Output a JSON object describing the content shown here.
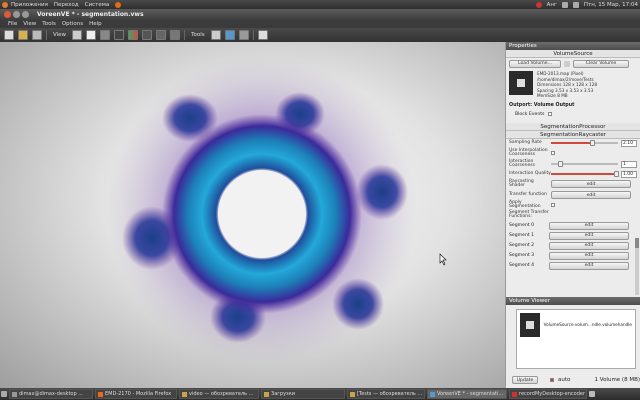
{
  "top_panel": {
    "menus": [
      "Приложения",
      "Переход",
      "Система"
    ],
    "clock": "Птн, 15 Мар, 17:04",
    "keyboard": "Анг"
  },
  "window": {
    "title": "VoreenVE * - segmentation.vws"
  },
  "menubar": [
    "File",
    "View",
    "Tools",
    "Options",
    "Help"
  ],
  "toolbar": {
    "view_label": "View",
    "tools_label": "Tools"
  },
  "properties": {
    "dock_title": "Properties",
    "volume_source": {
      "title": "VolumeSource",
      "load_button": "Load Volume...",
      "clear_button": "Clear Volume",
      "filename": "EMD-2013.map (Pixel)",
      "path": "/home/dimax/2/move/Tests",
      "dimensions": "Dimensions  128 x 128 x 128",
      "spacing": "Spacing  3.53 x 3.53 x 3.53",
      "memsize": "MemSize  8 MB",
      "outport": "Outport: Volume Output",
      "block_events": "Block Events"
    },
    "segmentation_processor": {
      "title": "SegmentationProcessor"
    },
    "raycaster": {
      "title": "SegmentationRaycaster",
      "sampling_rate_label": "Sampling Rate",
      "sampling_rate_value": "2.10",
      "sampling_rate": 0.62,
      "use_interp_label": "Use Interpolation Coarseness",
      "interaction_coarseness_label": "Interaction Coarseness",
      "interaction_coarseness_value": "1",
      "interaction_coarseness": 0.15,
      "interaction_quality_label": "Interaction Quality",
      "interaction_quality_value": "1.00",
      "interaction_quality": 0.98,
      "raycasting_shader_label": "Raycasting Shader",
      "transfer_function_label": "Transfer function",
      "apply_segmentation_label": "Apply Segmentation",
      "segment_tf_label": "Segment Transfer Functions:",
      "edit_label": "edit",
      "segments": [
        "Segment 0",
        "Segment 1",
        "Segment 2",
        "Segment 3",
        "Segment 4"
      ]
    }
  },
  "volume_viewer": {
    "dock_title": "Volume Viewer",
    "item_label": "VolumeSource.volum...ndle.volumehandle",
    "update_button": "Update",
    "auto_label": "auto",
    "count": "1 Volume (8 MB)"
  },
  "taskbar": [
    "dimax@dimax-desktop ...",
    "EMD-2170 - Mozilla Firefox",
    "video — обозреватель ...",
    "Загрузки",
    "[Tests — обозреватель ...",
    "VoreenVE * - segmentati...",
    "recordMyDesktop-encoder"
  ],
  "colors": {
    "accent": "#d04a3c",
    "panel": "#3b3b3b"
  }
}
